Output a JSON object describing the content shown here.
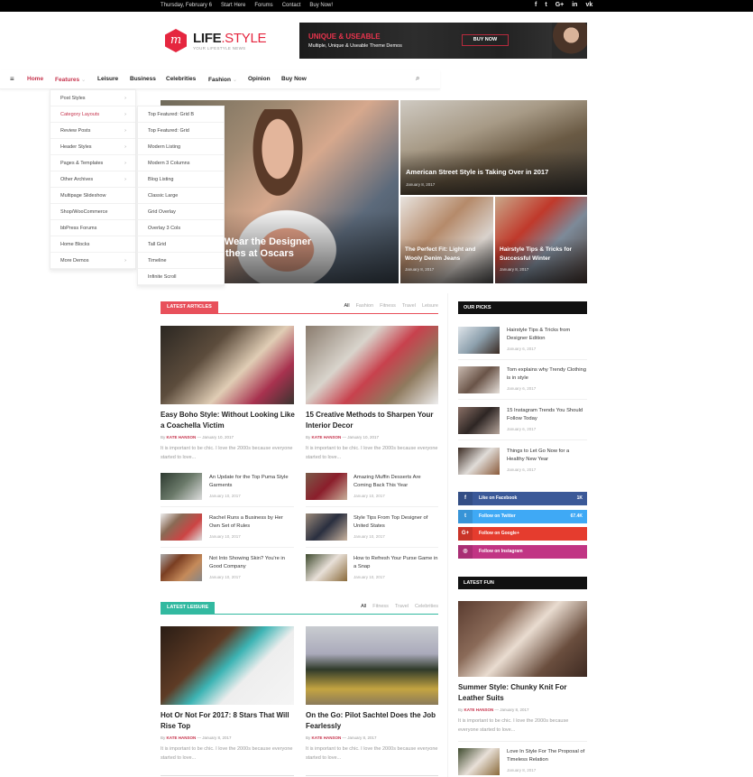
{
  "topbar": {
    "date": "Thursday, February 6",
    "links": [
      "Start Here",
      "Forums",
      "Contact",
      "Buy Now!"
    ],
    "social_icons": [
      "facebook-icon",
      "twitter-icon",
      "google-plus-icon",
      "linkedin-icon",
      "vk-icon"
    ],
    "social_glyphs": [
      "f",
      "t",
      "G+",
      "in",
      "vk"
    ]
  },
  "logo": {
    "name_main": "LIFE",
    "name_accent": ".STYLE",
    "tagline": "YOUR LIFESTYLE NEWS",
    "mark": "m"
  },
  "ad": {
    "title": "UNIQUE & USEABLE",
    "subtitle": "Multiple, Unique & Useable Theme Demos",
    "button": "BUY NOW"
  },
  "nav": {
    "items": [
      {
        "label": "Home",
        "active": true
      },
      {
        "label": "Features",
        "dropdown": true,
        "active": true
      },
      {
        "label": "Leisure"
      },
      {
        "label": "Business"
      },
      {
        "label": "Celebrities"
      },
      {
        "label": "Fashion",
        "dropdown": true
      },
      {
        "label": "Opinion"
      },
      {
        "label": "Buy Now"
      }
    ]
  },
  "features_menu": [
    {
      "label": "Post Styles",
      "sub": true
    },
    {
      "label": "Category Layouts",
      "sub": true,
      "active": true
    },
    {
      "label": "Review Posts",
      "sub": true
    },
    {
      "label": "Header Styles",
      "sub": true
    },
    {
      "label": "Pages & Templates",
      "sub": true
    },
    {
      "label": "Other Archives",
      "sub": true
    },
    {
      "label": "Multipage Slideshow"
    },
    {
      "label": "Shop/WooCommerce"
    },
    {
      "label": "bbPress Forums"
    },
    {
      "label": "Home Blocks"
    },
    {
      "label": "More Demos",
      "sub": true
    }
  ],
  "category_layouts_menu": [
    "Top Featured: Grid B",
    "Top Featured: Grid",
    "Modern Listing",
    "Modern 3 Columns",
    "Blog Listing",
    "Classic Large",
    "Grid Overlay",
    "Overlay 3 Cols",
    "Tall Grid",
    "Timeline",
    "Infinite Scroll"
  ],
  "hero": {
    "main": {
      "title_line1": "r to Wear the Designer",
      "title_line2": "thes at Oscars"
    },
    "top_right": {
      "title": "American Street Style is Taking Over in 2017",
      "date": "January 8, 2017"
    },
    "bottom_left": {
      "title": "The Perfect Fit: Light and Wooly Denim Jeans",
      "date": "January 8, 2017"
    },
    "bottom_right": {
      "title": "Hairstyle Tips & Tricks for Successful Winter",
      "date": "January 8, 2017"
    }
  },
  "latest_articles": {
    "label": "LATEST ARTICLES",
    "color": "#e8505b",
    "filters": [
      "All",
      "Fashion",
      "Fitness",
      "Travel",
      "Leisure"
    ],
    "featured": [
      {
        "title": "Easy Boho Style: Without Looking Like a Coachella Victim",
        "by": "By",
        "author": "KATE HANSON",
        "date": "January 10, 2017",
        "excerpt": "It is important to be chic. I love the 2000s because everyone started to love..."
      },
      {
        "title": "15 Creative Methods to Sharpen Your Interior Decor",
        "by": "By",
        "author": "KATE HANSON",
        "date": "January 10, 2017",
        "excerpt": "It is important to be chic. I love the 2000s because everyone started to love..."
      }
    ],
    "list": [
      {
        "title": "An Update for the Top Puma Style Garments",
        "date": "January 10, 2017"
      },
      {
        "title": "Amazing Muffin Desserts Are Coming Back This Year",
        "date": "January 10, 2017"
      },
      {
        "title": "Rachel Runs a Business by Her Own Set of Rules",
        "date": "January 10, 2017"
      },
      {
        "title": "Style Tips From Top Designer of United States",
        "date": "January 10, 2017"
      },
      {
        "title": "Not Into Showing Skin? You're in Good Company",
        "date": "January 10, 2017"
      },
      {
        "title": "How to Refresh Your Purse Game in a Snap",
        "date": "January 10, 2017"
      }
    ]
  },
  "latest_leisure": {
    "label": "LATEST LEISURE",
    "color": "#32b9a0",
    "filters": [
      "All",
      "Fitness",
      "Travel",
      "Celebrities"
    ],
    "featured": [
      {
        "title": "Hot Or Not For 2017: 8 Stars That Will Rise Top",
        "by": "By",
        "author": "KATE HANSON",
        "date": "January 8, 2017",
        "excerpt": "It is important to be chic. I love the 2000s because everyone started to love..."
      },
      {
        "title": "On the Go: Pilot Sachtel Does the Job Fearlessly",
        "by": "By",
        "author": "KATE HANSON",
        "date": "January 8, 2017",
        "excerpt": "It is important to be chic. I love the 2000s because everyone started to love..."
      }
    ]
  },
  "our_picks": {
    "label": "OUR PICKS",
    "items": [
      {
        "title": "Hairstyle Tips & Tricks from Designer Edition",
        "date": "January 6, 2017"
      },
      {
        "title": "Tom explains why Trendy Clothing is in style",
        "date": "January 6, 2017"
      },
      {
        "title": "15 Instagram Trends You Should Follow Today",
        "date": "January 6, 2017"
      },
      {
        "title": "Things to Let Go Now for a Healthy New Year",
        "date": "January 6, 2017"
      }
    ]
  },
  "social_counters": [
    {
      "label": "Like on Facebook",
      "count": "1K",
      "glyph": "f",
      "color": "#3b5998"
    },
    {
      "label": "Follow on Twitter",
      "count": "67.4K",
      "glyph": "t",
      "color": "#3fa9f5"
    },
    {
      "label": "Follow on Google+",
      "count": "",
      "glyph": "G+",
      "color": "#e53c2e"
    },
    {
      "label": "Follow on Instagram",
      "count": "",
      "glyph": "◎",
      "color": "#c13584"
    }
  ],
  "latest_fun": {
    "label": "LATEST FUN",
    "featured": {
      "title": "Summer Style: Chunky Knit For Leather Suits",
      "by": "By",
      "author": "KATE HANSON",
      "date": "January 8, 2017",
      "excerpt": "It is important to be chic. I love the 2000s because everyone started to love..."
    },
    "list": [
      {
        "title": "Love In Style For The Proposal of Timeless Relation",
        "date": "January 8, 2017"
      }
    ]
  }
}
